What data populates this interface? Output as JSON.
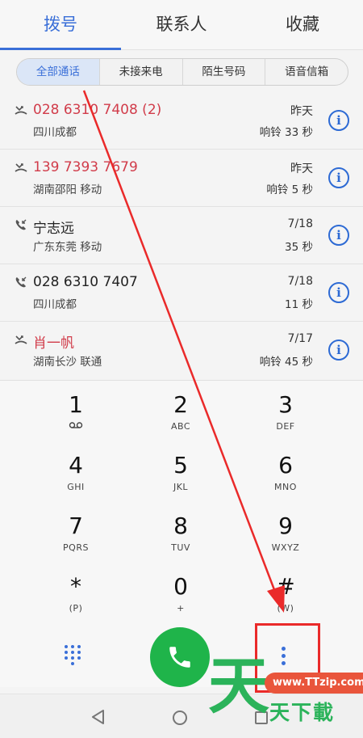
{
  "tabs": [
    {
      "label": "拨号",
      "active": true
    },
    {
      "label": "联系人",
      "active": false
    },
    {
      "label": "收藏",
      "active": false
    }
  ],
  "filters": [
    {
      "label": "全部通话",
      "active": true
    },
    {
      "label": "未接来电",
      "active": false
    },
    {
      "label": "陌生号码",
      "active": false
    },
    {
      "label": "语音信箱",
      "active": false
    }
  ],
  "calls": [
    {
      "type": "missed",
      "name": "028 6310 7408 (2)",
      "location": "四川成都",
      "date": "昨天",
      "duration": "响铃 33 秒"
    },
    {
      "type": "missed",
      "name": "139 7393 7679",
      "location": "湖南邵阳 移动",
      "date": "昨天",
      "duration": "响铃 5 秒"
    },
    {
      "type": "incoming",
      "name": "宁志远",
      "location": "广东东莞 移动",
      "date": "7/18",
      "duration": "35 秒"
    },
    {
      "type": "incoming",
      "name": "028 6310 7407",
      "location": "四川成都",
      "date": "7/18",
      "duration": "11 秒"
    },
    {
      "type": "missed",
      "name": "肖一帆",
      "location": "湖南长沙 联通",
      "date": "7/17",
      "duration": "响铃 45 秒"
    }
  ],
  "info_glyph": "i",
  "keys": [
    {
      "num": "1",
      "sub": "voicemail-icon"
    },
    {
      "num": "2",
      "sub": "ABC"
    },
    {
      "num": "3",
      "sub": "DEF"
    },
    {
      "num": "4",
      "sub": "GHI"
    },
    {
      "num": "5",
      "sub": "JKL"
    },
    {
      "num": "6",
      "sub": "MNO"
    },
    {
      "num": "7",
      "sub": "PQRS"
    },
    {
      "num": "8",
      "sub": "TUV"
    },
    {
      "num": "9",
      "sub": "WXYZ"
    },
    {
      "num": "*",
      "sub": "(P)"
    },
    {
      "num": "0",
      "sub": "+"
    },
    {
      "num": "#",
      "sub": "(W)"
    }
  ],
  "colors": {
    "accent": "#3a6fd8",
    "missed": "#d13c4a",
    "call_button": "#1fb44a",
    "annotation": "#ea2a2a",
    "watermark_green": "#2bb35a",
    "watermark_badge": "#e9553b"
  },
  "icons": {
    "dialpad": "dialpad-icon",
    "call": "phone-icon",
    "more": "more-vertical-icon",
    "back": "nav-back-icon",
    "home": "nav-home-icon",
    "recent": "nav-recent-icon"
  },
  "watermark": {
    "big_char": "天",
    "url": "www.TTzip.com",
    "text": "天下載"
  }
}
